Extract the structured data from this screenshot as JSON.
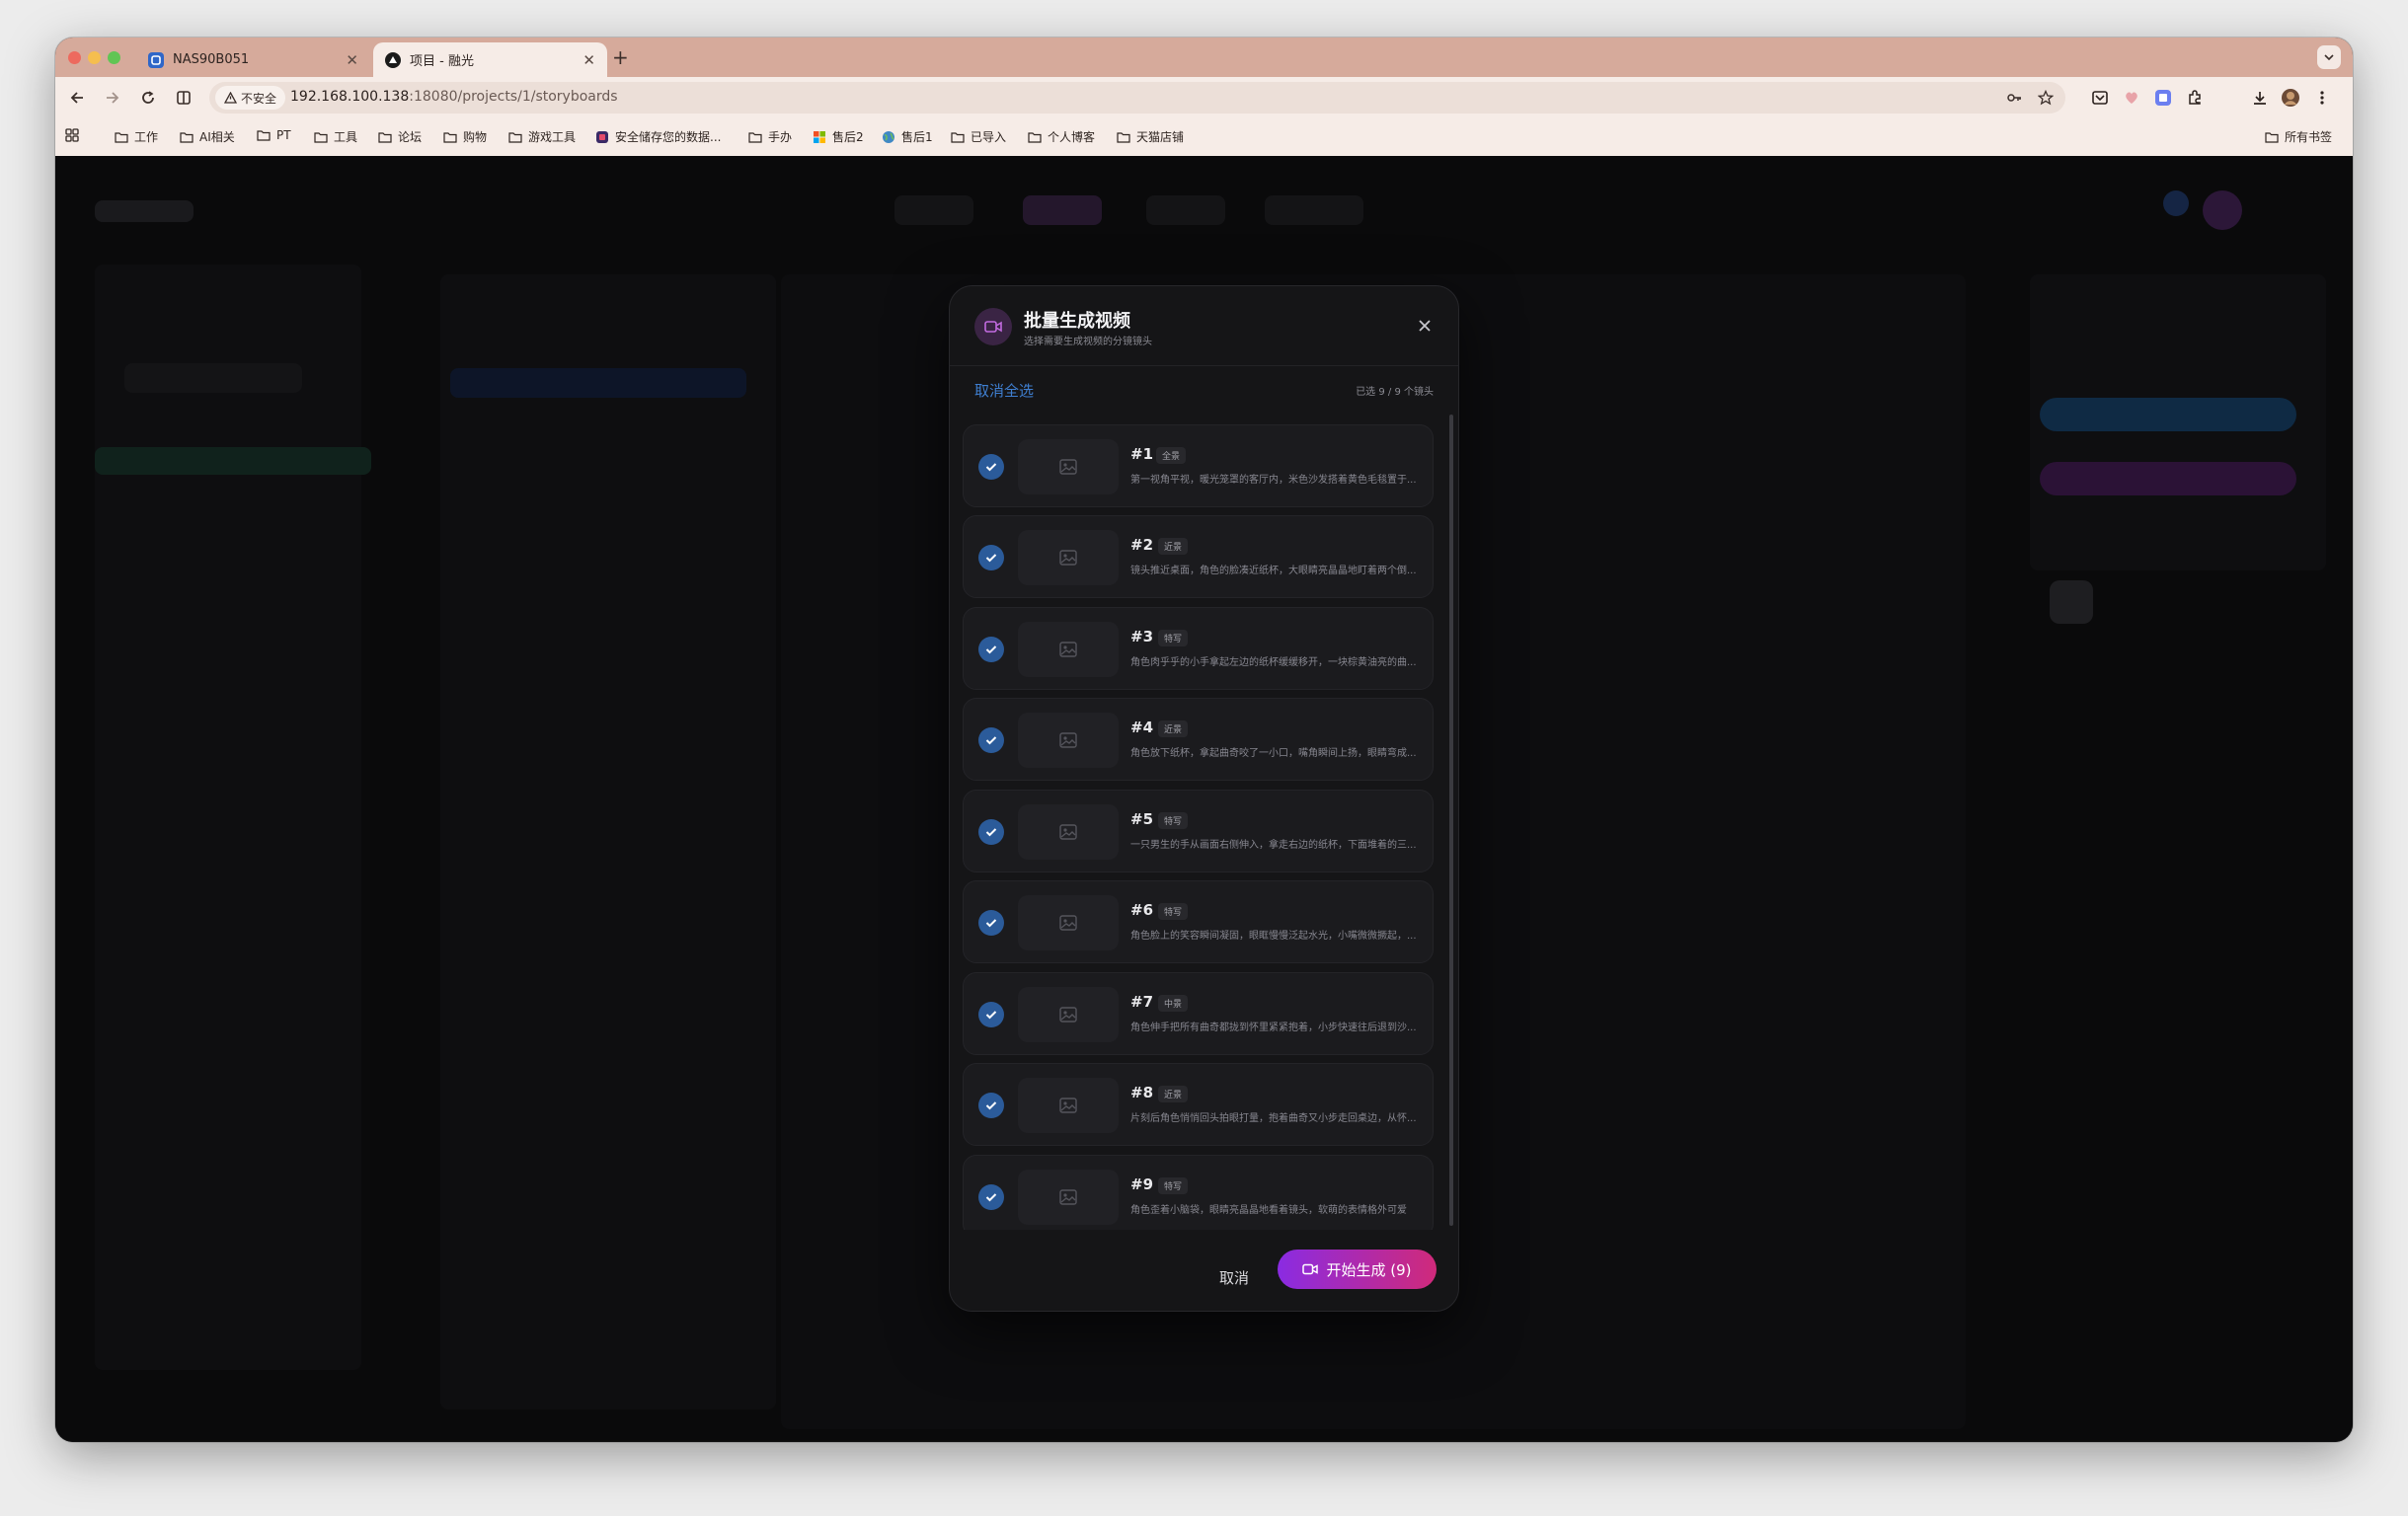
{
  "browser": {
    "tabs": [
      {
        "title": "NAS90B051",
        "active": false
      },
      {
        "title": "项目 - 融光",
        "active": true
      }
    ],
    "new_tab": "+",
    "address": {
      "security_label": "不安全",
      "host": "192.168.100.138",
      "rest": ":18080/projects/1/storyboards"
    },
    "bookmarks": [
      "工作",
      "AI相关",
      "PT",
      "工具",
      "论坛",
      "购物",
      "游戏工具",
      "安全储存您的数据...",
      "手办",
      "售后2",
      "售后1",
      "已导入",
      "个人博客",
      "天猫店铺"
    ],
    "all_bookmarks": "所有书签"
  },
  "modal": {
    "title": "批量生成视频",
    "subtitle": "选择需要生成视频的分镜镜头",
    "deselect_all": "取消全选",
    "selected_count": "已选 9 / 9 个镜头",
    "items": [
      {
        "num": "#1",
        "tag": "全景",
        "desc": "第一视角平视，暖光笼罩的客厅内，米色沙发搭着黄色毛毯置于..."
      },
      {
        "num": "#2",
        "tag": "近景",
        "desc": "镜头推近桌面，角色的脸凑近纸杯，大眼睛亮晶晶地盯着两个倒..."
      },
      {
        "num": "#3",
        "tag": "特写",
        "desc": "角色肉乎乎的小手拿起左边的纸杯缓缓移开，一块棕黄油亮的曲..."
      },
      {
        "num": "#4",
        "tag": "近景",
        "desc": "角色放下纸杯，拿起曲奇咬了一小口，嘴角瞬间上扬，眼睛弯成..."
      },
      {
        "num": "#5",
        "tag": "特写",
        "desc": "一只男生的手从画面右侧伸入，拿走右边的纸杯，下面堆着的三..."
      },
      {
        "num": "#6",
        "tag": "特写",
        "desc": "角色脸上的笑容瞬间凝固，眼眶慢慢泛起水光，小嘴微微撅起，..."
      },
      {
        "num": "#7",
        "tag": "中景",
        "desc": "角色伸手把所有曲奇都拢到怀里紧紧抱着，小步快速往后退到沙..."
      },
      {
        "num": "#8",
        "tag": "近景",
        "desc": "片刻后角色悄悄回头拍眼打量，抱着曲奇又小步走回桌边，从怀..."
      },
      {
        "num": "#9",
        "tag": "特写",
        "desc": "角色歪着小脑袋，眼睛亮晶晶地看着镜头，软萌的表情格外可爱"
      }
    ],
    "cancel": "取消",
    "start": "开始生成 (9)"
  }
}
